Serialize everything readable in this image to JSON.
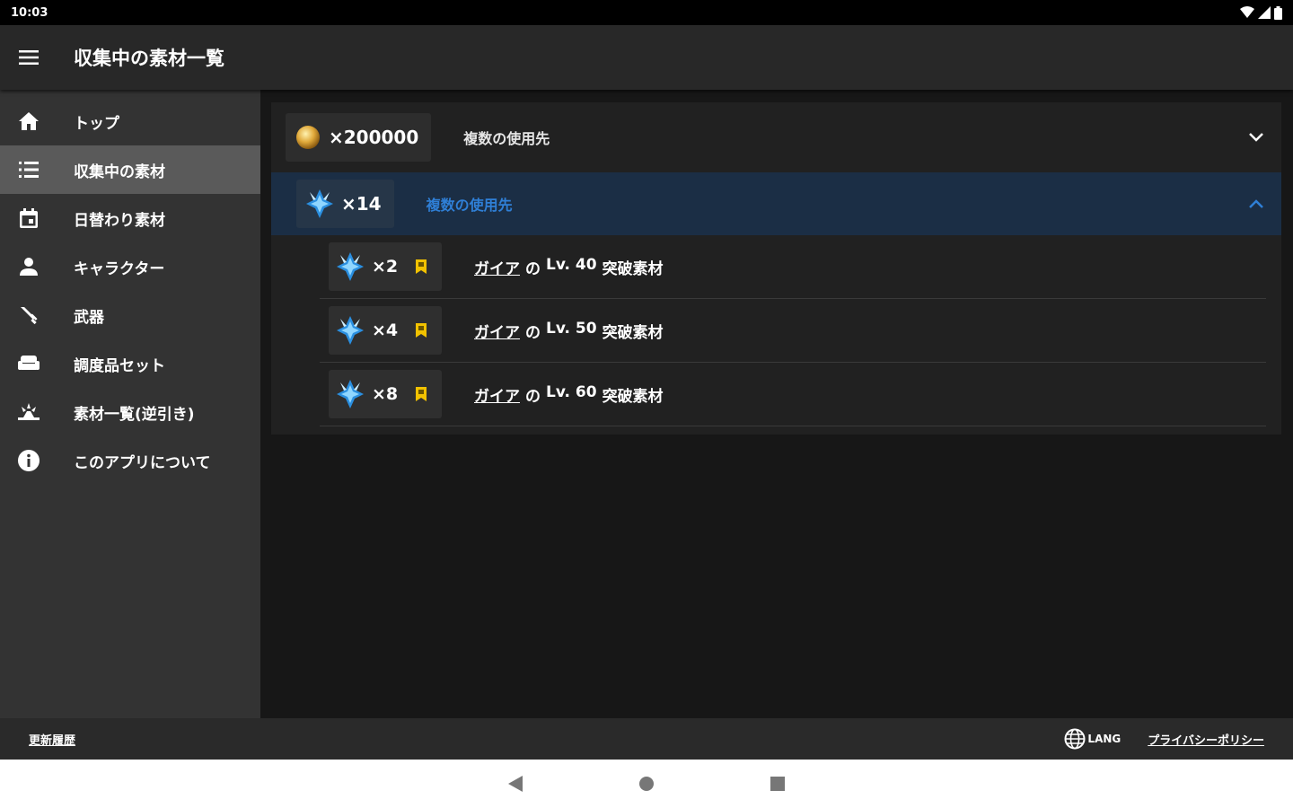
{
  "status_bar": {
    "time": "10:03"
  },
  "app_bar": {
    "title": "収集中の素材一覧"
  },
  "sidebar": {
    "items": [
      {
        "label": "トップ",
        "icon": "home-icon"
      },
      {
        "label": "収集中の素材",
        "icon": "list-icon",
        "active": true
      },
      {
        "label": "日替わり素材",
        "icon": "calendar-icon"
      },
      {
        "label": "キャラクター",
        "icon": "person-icon"
      },
      {
        "label": "武器",
        "icon": "sword-icon"
      },
      {
        "label": "調度品セット",
        "icon": "sofa-icon"
      },
      {
        "label": "素材一覧(逆引き)",
        "icon": "material-icon"
      },
      {
        "label": "このアプリについて",
        "icon": "info-icon"
      }
    ]
  },
  "materials": {
    "row1": {
      "count": "×200000",
      "label": "複数の使用先",
      "icon": "mora-coin-icon"
    },
    "row2": {
      "count": "×14",
      "label": "複数の使用先",
      "icon": "crystal-icon"
    },
    "sub_rows": [
      {
        "count": "×2",
        "character": "ガイア",
        "of": "の",
        "level": "Lv. 40",
        "suffix": "突破素材"
      },
      {
        "count": "×4",
        "character": "ガイア",
        "of": "の",
        "level": "Lv. 50",
        "suffix": "突破素材"
      },
      {
        "count": "×8",
        "character": "ガイア",
        "of": "の",
        "level": "Lv. 60",
        "suffix": "突破素材"
      }
    ]
  },
  "footer": {
    "update_history": "更新履歴",
    "lang": "LANG",
    "privacy": "プライバシーポリシー"
  },
  "colors": {
    "accent_blue": "#2f7fd6",
    "selected_row": "#1b2e45",
    "flag_yellow": "#f2c200"
  }
}
